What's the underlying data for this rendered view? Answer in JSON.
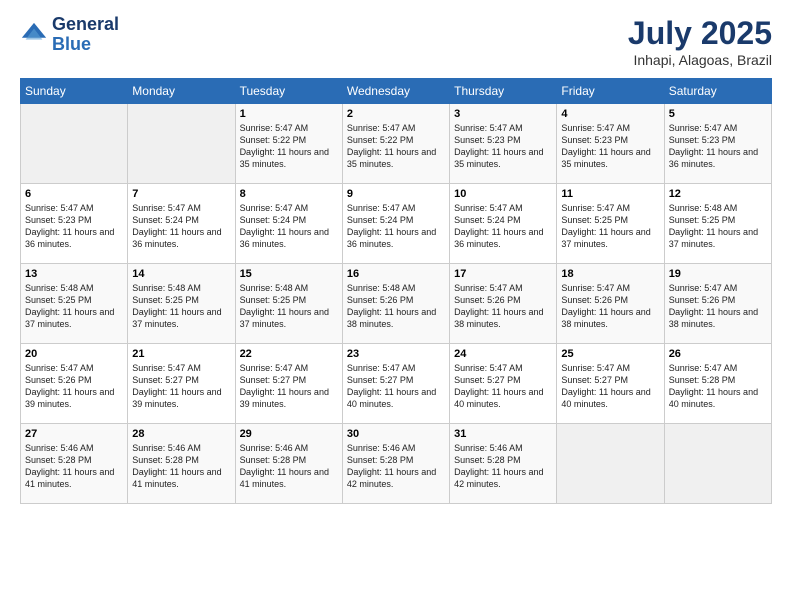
{
  "header": {
    "logo_line1": "General",
    "logo_line2": "Blue",
    "month": "July 2025",
    "location": "Inhapi, Alagoas, Brazil"
  },
  "days_of_week": [
    "Sunday",
    "Monday",
    "Tuesday",
    "Wednesday",
    "Thursday",
    "Friday",
    "Saturday"
  ],
  "weeks": [
    [
      {
        "day": "",
        "sunrise": "",
        "sunset": "",
        "daylight": ""
      },
      {
        "day": "",
        "sunrise": "",
        "sunset": "",
        "daylight": ""
      },
      {
        "day": "1",
        "sunrise": "Sunrise: 5:47 AM",
        "sunset": "Sunset: 5:22 PM",
        "daylight": "Daylight: 11 hours and 35 minutes."
      },
      {
        "day": "2",
        "sunrise": "Sunrise: 5:47 AM",
        "sunset": "Sunset: 5:22 PM",
        "daylight": "Daylight: 11 hours and 35 minutes."
      },
      {
        "day": "3",
        "sunrise": "Sunrise: 5:47 AM",
        "sunset": "Sunset: 5:23 PM",
        "daylight": "Daylight: 11 hours and 35 minutes."
      },
      {
        "day": "4",
        "sunrise": "Sunrise: 5:47 AM",
        "sunset": "Sunset: 5:23 PM",
        "daylight": "Daylight: 11 hours and 35 minutes."
      },
      {
        "day": "5",
        "sunrise": "Sunrise: 5:47 AM",
        "sunset": "Sunset: 5:23 PM",
        "daylight": "Daylight: 11 hours and 36 minutes."
      }
    ],
    [
      {
        "day": "6",
        "sunrise": "Sunrise: 5:47 AM",
        "sunset": "Sunset: 5:23 PM",
        "daylight": "Daylight: 11 hours and 36 minutes."
      },
      {
        "day": "7",
        "sunrise": "Sunrise: 5:47 AM",
        "sunset": "Sunset: 5:24 PM",
        "daylight": "Daylight: 11 hours and 36 minutes."
      },
      {
        "day": "8",
        "sunrise": "Sunrise: 5:47 AM",
        "sunset": "Sunset: 5:24 PM",
        "daylight": "Daylight: 11 hours and 36 minutes."
      },
      {
        "day": "9",
        "sunrise": "Sunrise: 5:47 AM",
        "sunset": "Sunset: 5:24 PM",
        "daylight": "Daylight: 11 hours and 36 minutes."
      },
      {
        "day": "10",
        "sunrise": "Sunrise: 5:47 AM",
        "sunset": "Sunset: 5:24 PM",
        "daylight": "Daylight: 11 hours and 36 minutes."
      },
      {
        "day": "11",
        "sunrise": "Sunrise: 5:47 AM",
        "sunset": "Sunset: 5:25 PM",
        "daylight": "Daylight: 11 hours and 37 minutes."
      },
      {
        "day": "12",
        "sunrise": "Sunrise: 5:48 AM",
        "sunset": "Sunset: 5:25 PM",
        "daylight": "Daylight: 11 hours and 37 minutes."
      }
    ],
    [
      {
        "day": "13",
        "sunrise": "Sunrise: 5:48 AM",
        "sunset": "Sunset: 5:25 PM",
        "daylight": "Daylight: 11 hours and 37 minutes."
      },
      {
        "day": "14",
        "sunrise": "Sunrise: 5:48 AM",
        "sunset": "Sunset: 5:25 PM",
        "daylight": "Daylight: 11 hours and 37 minutes."
      },
      {
        "day": "15",
        "sunrise": "Sunrise: 5:48 AM",
        "sunset": "Sunset: 5:25 PM",
        "daylight": "Daylight: 11 hours and 37 minutes."
      },
      {
        "day": "16",
        "sunrise": "Sunrise: 5:48 AM",
        "sunset": "Sunset: 5:26 PM",
        "daylight": "Daylight: 11 hours and 38 minutes."
      },
      {
        "day": "17",
        "sunrise": "Sunrise: 5:47 AM",
        "sunset": "Sunset: 5:26 PM",
        "daylight": "Daylight: 11 hours and 38 minutes."
      },
      {
        "day": "18",
        "sunrise": "Sunrise: 5:47 AM",
        "sunset": "Sunset: 5:26 PM",
        "daylight": "Daylight: 11 hours and 38 minutes."
      },
      {
        "day": "19",
        "sunrise": "Sunrise: 5:47 AM",
        "sunset": "Sunset: 5:26 PM",
        "daylight": "Daylight: 11 hours and 38 minutes."
      }
    ],
    [
      {
        "day": "20",
        "sunrise": "Sunrise: 5:47 AM",
        "sunset": "Sunset: 5:26 PM",
        "daylight": "Daylight: 11 hours and 39 minutes."
      },
      {
        "day": "21",
        "sunrise": "Sunrise: 5:47 AM",
        "sunset": "Sunset: 5:27 PM",
        "daylight": "Daylight: 11 hours and 39 minutes."
      },
      {
        "day": "22",
        "sunrise": "Sunrise: 5:47 AM",
        "sunset": "Sunset: 5:27 PM",
        "daylight": "Daylight: 11 hours and 39 minutes."
      },
      {
        "day": "23",
        "sunrise": "Sunrise: 5:47 AM",
        "sunset": "Sunset: 5:27 PM",
        "daylight": "Daylight: 11 hours and 40 minutes."
      },
      {
        "day": "24",
        "sunrise": "Sunrise: 5:47 AM",
        "sunset": "Sunset: 5:27 PM",
        "daylight": "Daylight: 11 hours and 40 minutes."
      },
      {
        "day": "25",
        "sunrise": "Sunrise: 5:47 AM",
        "sunset": "Sunset: 5:27 PM",
        "daylight": "Daylight: 11 hours and 40 minutes."
      },
      {
        "day": "26",
        "sunrise": "Sunrise: 5:47 AM",
        "sunset": "Sunset: 5:28 PM",
        "daylight": "Daylight: 11 hours and 40 minutes."
      }
    ],
    [
      {
        "day": "27",
        "sunrise": "Sunrise: 5:46 AM",
        "sunset": "Sunset: 5:28 PM",
        "daylight": "Daylight: 11 hours and 41 minutes."
      },
      {
        "day": "28",
        "sunrise": "Sunrise: 5:46 AM",
        "sunset": "Sunset: 5:28 PM",
        "daylight": "Daylight: 11 hours and 41 minutes."
      },
      {
        "day": "29",
        "sunrise": "Sunrise: 5:46 AM",
        "sunset": "Sunset: 5:28 PM",
        "daylight": "Daylight: 11 hours and 41 minutes."
      },
      {
        "day": "30",
        "sunrise": "Sunrise: 5:46 AM",
        "sunset": "Sunset: 5:28 PM",
        "daylight": "Daylight: 11 hours and 42 minutes."
      },
      {
        "day": "31",
        "sunrise": "Sunrise: 5:46 AM",
        "sunset": "Sunset: 5:28 PM",
        "daylight": "Daylight: 11 hours and 42 minutes."
      },
      {
        "day": "",
        "sunrise": "",
        "sunset": "",
        "daylight": ""
      },
      {
        "day": "",
        "sunrise": "",
        "sunset": "",
        "daylight": ""
      }
    ]
  ]
}
